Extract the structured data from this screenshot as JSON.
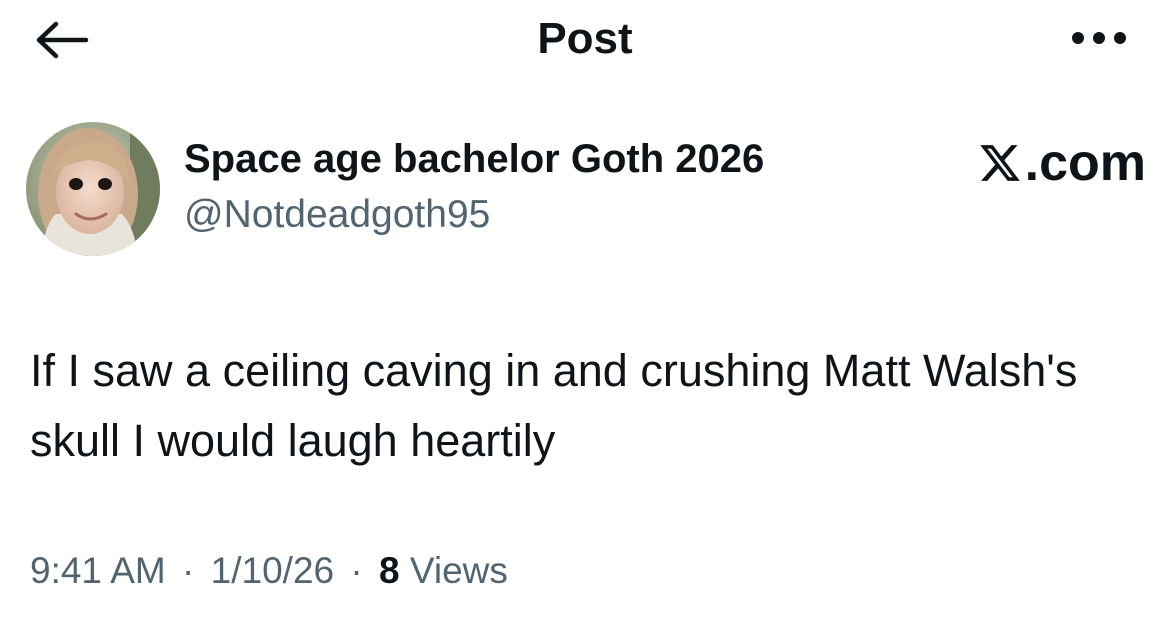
{
  "header": {
    "title": "Post",
    "back_icon": "arrow-left-icon",
    "more_icon": "more-horizontal-icon"
  },
  "author": {
    "display_name": "Space age bachelor Goth 2026",
    "handle": "@Notdeadgoth95",
    "avatar": "profile-photo"
  },
  "brand": {
    "logo_icon": "x-logo-icon",
    "text": ".com"
  },
  "tweet": {
    "text": "If I saw a ceiling caving in and crushing Matt Walsh's skull I would laugh heartily"
  },
  "meta": {
    "time": "9:41 AM",
    "separator": "·",
    "date": "1/10/26",
    "views_count": "8",
    "views_label": "Views"
  },
  "colors": {
    "text_primary": "#0f1419",
    "text_secondary": "#536471",
    "background": "#ffffff"
  }
}
